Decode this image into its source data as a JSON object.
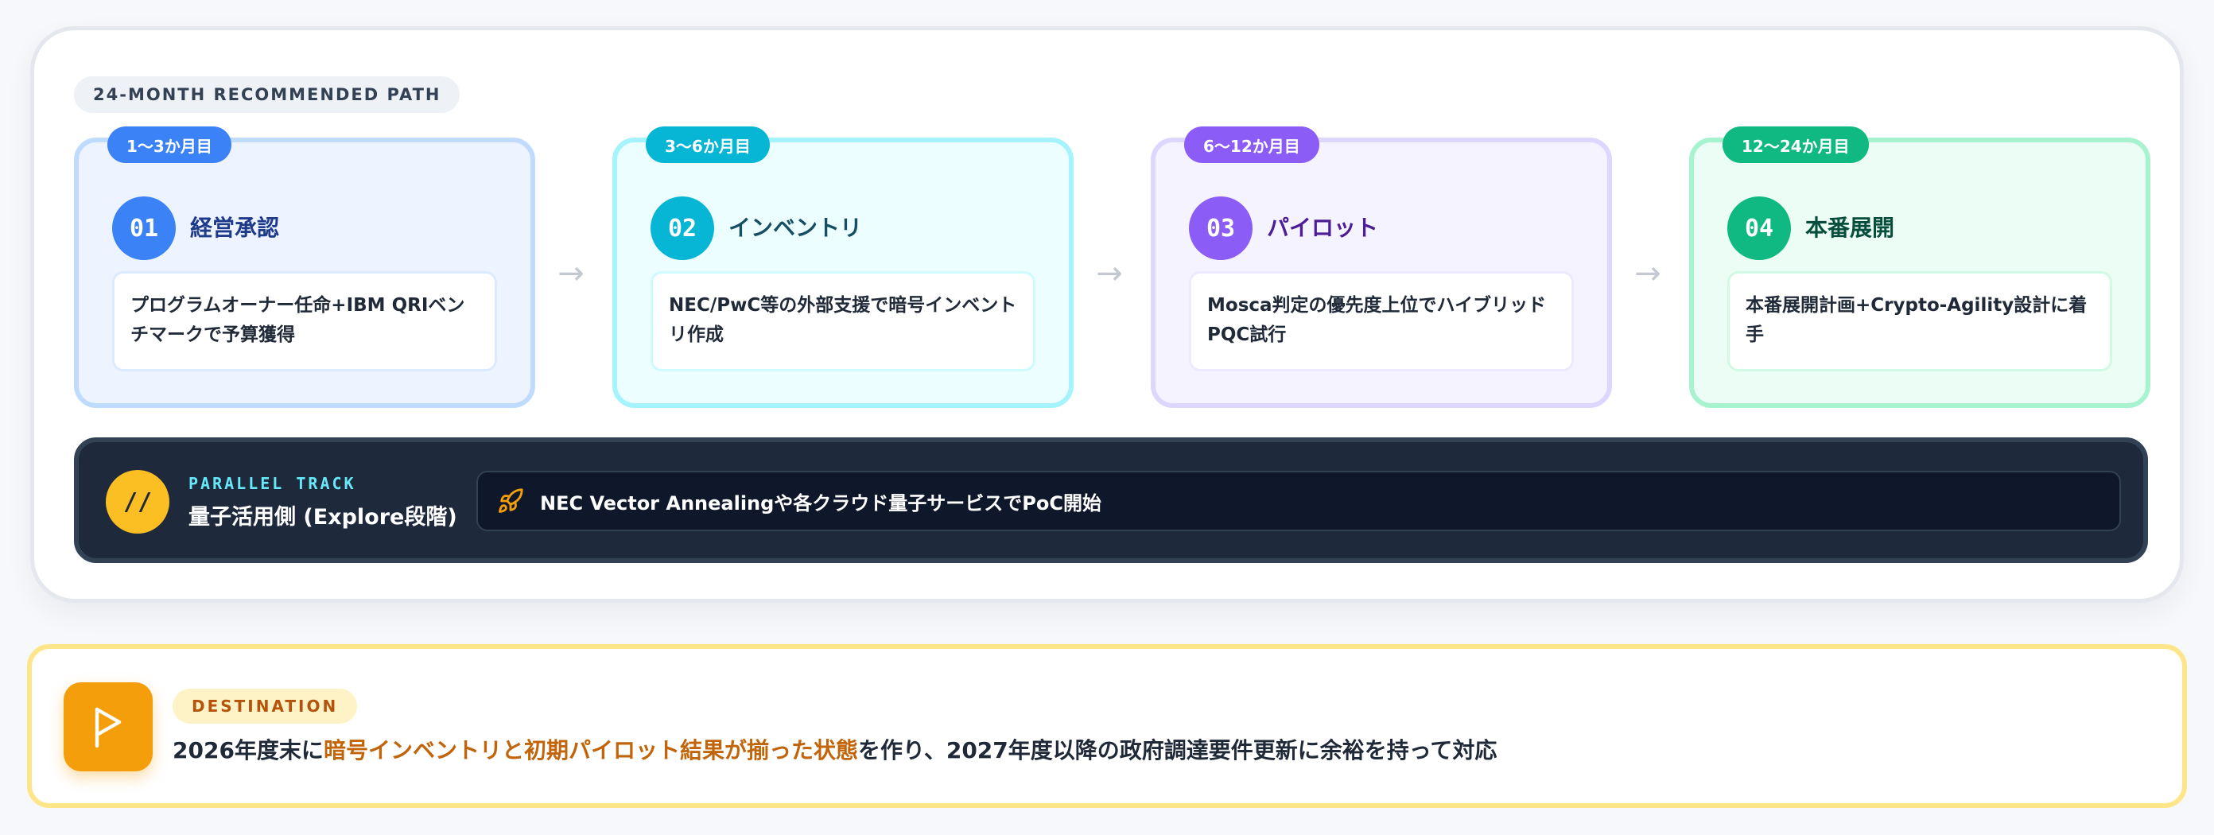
{
  "roadmap": {
    "badge": "24-MONTH RECOMMENDED PATH",
    "phases": [
      {
        "period": "1〜3か月目",
        "number": "01",
        "title": "経営承認",
        "description": "プログラムオーナー任命+IBM QRIベンチマークで予算獲得",
        "accent": "#3b82f6"
      },
      {
        "period": "3〜6か月目",
        "number": "02",
        "title": "インベントリ",
        "description": "NEC/PwC等の外部支援で暗号インベントリ作成",
        "accent": "#06b6d4"
      },
      {
        "period": "6〜12か月目",
        "number": "03",
        "title": "パイロット",
        "description": "Mosca判定の優先度上位でハイブリッドPQC試行",
        "accent": "#8b5cf6"
      },
      {
        "period": "12〜24か月目",
        "number": "04",
        "title": "本番展開",
        "description": "本番展開計画+Crypto-Agility設計に着手",
        "accent": "#10b981"
      }
    ],
    "arrow_glyph": "→"
  },
  "parallel_track": {
    "icon_text": "//",
    "label": "PARALLEL TRACK",
    "title": "量子活用側 (Explore段階)",
    "icon": "rocket-icon",
    "text": "NEC Vector Annealingや各クラウド量子サービスでPoC開始"
  },
  "destination": {
    "icon": "flag-icon",
    "badge": "DESTINATION",
    "text_before": "2026年度末に",
    "text_highlight": "暗号インベントリと初期パイロット結果が揃った状態",
    "text_after": "を作り、2027年度以降の政府調達要件更新に余裕を持って対応"
  }
}
